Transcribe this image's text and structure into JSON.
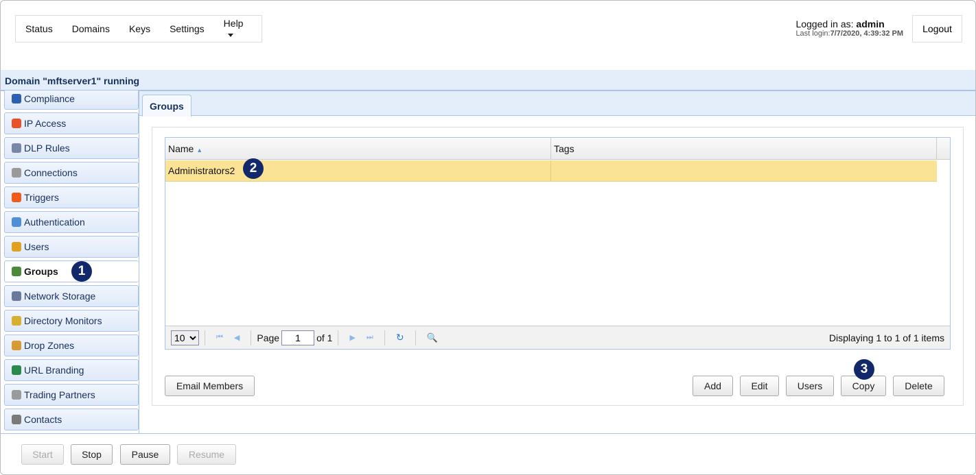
{
  "nav": {
    "items": [
      "Status",
      "Domains",
      "Keys",
      "Settings",
      "Help"
    ]
  },
  "login": {
    "prefix": "Logged in as: ",
    "user": "admin",
    "last_label": "Last login:",
    "last_value": "7/7/2020, 4:39:32 PM",
    "logout": "Logout"
  },
  "domain_title": "Domain \"mftserver1\" running",
  "sidebar": {
    "items": [
      {
        "label": "Compliance",
        "icon": "compliance-icon",
        "color": "#2d5fb5"
      },
      {
        "label": "IP Access",
        "icon": "firewall-icon",
        "color": "#e8502a"
      },
      {
        "label": "DLP Rules",
        "icon": "shield-icon",
        "color": "#7a86a8"
      },
      {
        "label": "Connections",
        "icon": "gear-icon",
        "color": "#9a9a9a"
      },
      {
        "label": "Triggers",
        "icon": "trigger-icon",
        "color": "#f05a1a"
      },
      {
        "label": "Authentication",
        "icon": "id-card-icon",
        "color": "#4f8fd8"
      },
      {
        "label": "Users",
        "icon": "user-icon",
        "color": "#e0a020"
      },
      {
        "label": "Groups",
        "icon": "group-icon",
        "color": "#4a8a3a"
      },
      {
        "label": "Network Storage",
        "icon": "network-storage-icon",
        "color": "#6a7a9a"
      },
      {
        "label": "Directory Monitors",
        "icon": "directory-monitor-icon",
        "color": "#d8b030"
      },
      {
        "label": "Drop Zones",
        "icon": "box-icon",
        "color": "#d89a30"
      },
      {
        "label": "URL Branding",
        "icon": "globe-icon",
        "color": "#2a8a4a"
      },
      {
        "label": "Trading Partners",
        "icon": "gear-icon",
        "color": "#9a9a9a"
      },
      {
        "label": "Contacts",
        "icon": "contacts-icon",
        "color": "#7a7a7a"
      }
    ],
    "active": "Groups"
  },
  "tab": "Groups",
  "grid": {
    "columns": [
      "Name",
      "Tags"
    ],
    "rows": [
      {
        "name": "Administrators2",
        "tags": ""
      }
    ]
  },
  "pager": {
    "page_size": "10",
    "page_label": "Page",
    "page": "1",
    "of": "of 1",
    "display": "Displaying 1 to 1 of 1 items"
  },
  "actions": {
    "email": "Email Members",
    "add": "Add",
    "edit": "Edit",
    "users": "Users",
    "copy": "Copy",
    "delete": "Delete"
  },
  "bottom": {
    "start": "Start",
    "stop": "Stop",
    "pause": "Pause",
    "resume": "Resume"
  },
  "badges": [
    "1",
    "2",
    "3"
  ]
}
